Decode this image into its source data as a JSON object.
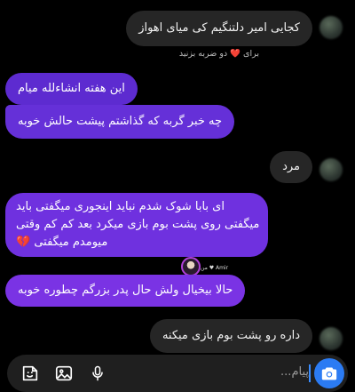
{
  "messages": [
    {
      "text": "کجایی امیر دلتنگیم کی میای اهواز"
    },
    {
      "text": "این هفته انشاءلله میام"
    },
    {
      "text": "چه خبر گربه که گذاشتم پیشت حالش خوبه"
    },
    {
      "text": "مرد"
    },
    {
      "line1": "ای بابا شوک شدم نباید اینجوری میگفتی باید",
      "line2": "میگفتی روی پشت بوم بازی میکرد بعد کم کم وقتی",
      "line3": "میومدم میگفتی"
    },
    {
      "text": "حالا بیخیال ولش حال پدر بزرگم چطوره خوبه"
    },
    {
      "text": "داره رو پشت بوم بازی میکنه"
    }
  ],
  "reply_hint": "برای ❤️ دو ضربه بزنید",
  "sticker_text": "من ♥ Amir",
  "composer": {
    "placeholder": "پیام..."
  },
  "icons": {
    "broken_heart": "💔"
  },
  "colors": {
    "out_top": "#6a2dd6",
    "out_bottom": "#7d32e6",
    "camera": "#2b7bf3"
  }
}
